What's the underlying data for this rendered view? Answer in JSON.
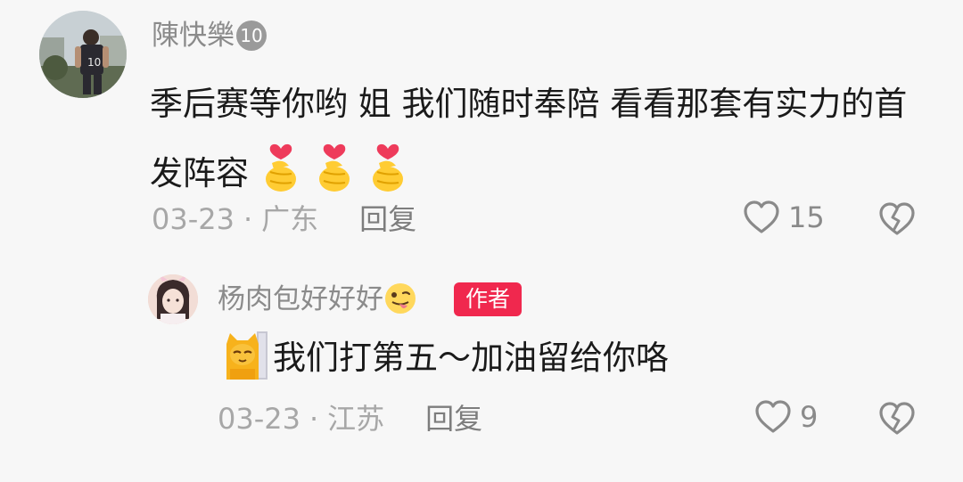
{
  "comment": {
    "username": "陳快樂",
    "level": "10",
    "text": "季后赛等你哟 姐 我们随时奉陪 看看那套有实力的首发阵容",
    "emoji": "finger-heart-emoji",
    "date": "03-23",
    "separator": "·",
    "location": "广东",
    "reply_label": "回复",
    "likes": "15",
    "avatar": "basketball-player-photo"
  },
  "reply": {
    "username": "杨肉包好好好",
    "username_emoji": "tongue-out-emoji",
    "author_badge": "作者",
    "sticker": "cat-sticker",
    "text": "我们打第五～加油留给你咯",
    "date": "03-23",
    "separator": "·",
    "location": "江苏",
    "reply_label": "回复",
    "likes": "9",
    "avatar": "girl-avatar-photo"
  },
  "colors": {
    "background": "#f7f7f7",
    "author_badge": "#f0284e",
    "meta_text": "#a7a7a7",
    "body_text": "#1a1a1a"
  }
}
